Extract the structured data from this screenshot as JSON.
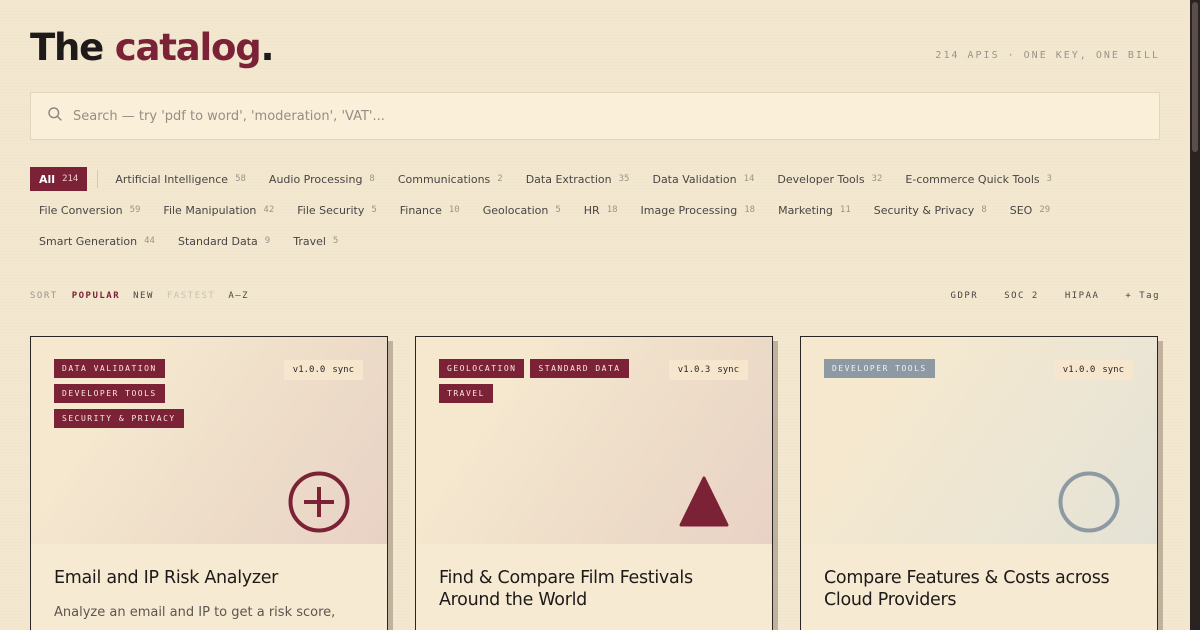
{
  "header": {
    "title_main": "The ",
    "title_accent": "catalog",
    "title_dot": ".",
    "tagline": "214 APIs · one key, one bill"
  },
  "search": {
    "placeholder": "Search — try 'pdf to word', 'moderation', 'VAT'...",
    "value": ""
  },
  "categories": [
    {
      "label": "All",
      "count": "214",
      "active": true
    },
    {
      "label": "Artificial Intelligence",
      "count": "58"
    },
    {
      "label": "Audio Processing",
      "count": "8"
    },
    {
      "label": "Communications",
      "count": "2"
    },
    {
      "label": "Data Extraction",
      "count": "35"
    },
    {
      "label": "Data Validation",
      "count": "14"
    },
    {
      "label": "Developer Tools",
      "count": "32"
    },
    {
      "label": "E-commerce Quick Tools",
      "count": "3"
    },
    {
      "label": "File Conversion",
      "count": "59"
    },
    {
      "label": "File Manipulation",
      "count": "42"
    },
    {
      "label": "File Security",
      "count": "5"
    },
    {
      "label": "Finance",
      "count": "10"
    },
    {
      "label": "Geolocation",
      "count": "5"
    },
    {
      "label": "HR",
      "count": "18"
    },
    {
      "label": "Image Processing",
      "count": "18"
    },
    {
      "label": "Marketing",
      "count": "11"
    },
    {
      "label": "Security & Privacy",
      "count": "8"
    },
    {
      "label": "SEO",
      "count": "29"
    },
    {
      "label": "Smart Generation",
      "count": "44"
    },
    {
      "label": "Standard Data",
      "count": "9"
    },
    {
      "label": "Travel",
      "count": "5"
    }
  ],
  "sort": {
    "label": "SORT",
    "options": [
      "POPULAR",
      "NEW",
      "FASTEST",
      "A–Z"
    ],
    "active": "POPULAR"
  },
  "tag_filters": [
    "GDPR",
    "SOC 2",
    "HIPAA"
  ],
  "add_tag_label": "+ Tag",
  "cards": [
    {
      "tags": [
        "DATA VALIDATION",
        "DEVELOPER TOOLS",
        "SECURITY & PRIVACY"
      ],
      "version": "v1.0.0",
      "sync": "sync",
      "icon": "plus-circle-icon",
      "title": "Email and IP Risk Analyzer",
      "description": "Analyze an email and IP to get a risk score,"
    },
    {
      "tags": [
        "GEOLOCATION",
        "STANDARD DATA",
        "TRAVEL"
      ],
      "version": "v1.0.3",
      "sync": "sync",
      "icon": "triangle-icon",
      "title": "Find & Compare Film Festivals Around the World",
      "description": ""
    },
    {
      "tags": [
        "DEVELOPER TOOLS"
      ],
      "version": "v1.0.0",
      "sync": "sync",
      "icon": "ring-icon",
      "title": "Compare Features & Costs across Cloud Providers",
      "description": ""
    }
  ],
  "colors": {
    "accent": "#7c2237",
    "background": "#f3e8cf",
    "muted_tag": "#8e9aa3"
  }
}
